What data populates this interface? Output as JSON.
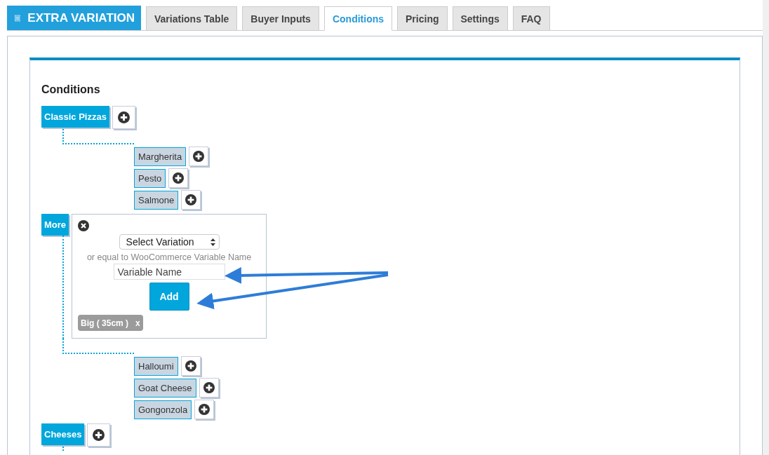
{
  "brand": {
    "title": "EXTRA VARIATION"
  },
  "tabs": [
    {
      "label": "Variations Table",
      "selected": false
    },
    {
      "label": "Buyer Inputs",
      "selected": false
    },
    {
      "label": "Conditions",
      "selected": true
    },
    {
      "label": "Pricing",
      "selected": false
    },
    {
      "label": "Settings",
      "selected": false
    },
    {
      "label": "FAQ",
      "selected": false
    }
  ],
  "section_title": "Conditions",
  "groups": [
    {
      "label": "Classic Pizzas",
      "expanded": true,
      "children": [
        {
          "label": "Margherita"
        },
        {
          "label": "Pesto"
        },
        {
          "label": "Salmone"
        }
      ]
    },
    {
      "label": "More",
      "expanded": true,
      "editor": {
        "select": "Select Variation",
        "hint": "or equal to WooCommerce Variable Name",
        "placeholder": "Variable Name",
        "button": "Add",
        "tags": [
          {
            "label": "Big ( 35cm )",
            "remove": "x"
          }
        ]
      },
      "children": [
        {
          "label": "Halloumi"
        },
        {
          "label": "Goat Cheese"
        },
        {
          "label": "Gongonzola"
        }
      ]
    },
    {
      "label": "Cheeses",
      "expanded": true
    }
  ]
}
